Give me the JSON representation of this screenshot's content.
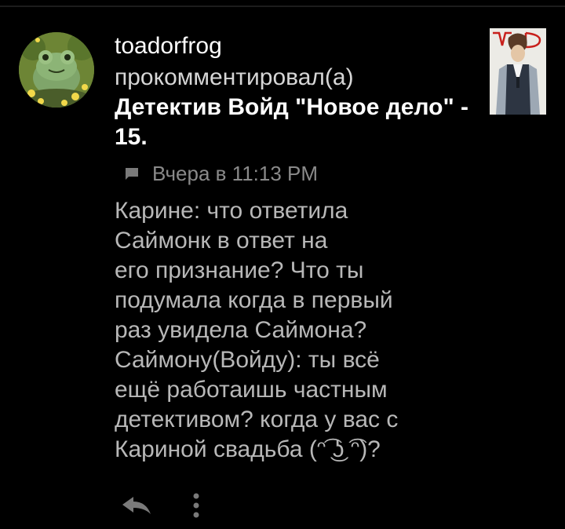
{
  "colors": {
    "background": "#000000",
    "username": "#ffffff",
    "action_text": "#d6d6d6",
    "title_text": "#ffffff",
    "meta_text": "#8a8a8a",
    "body_text": "#b8b8b8",
    "icon": "#7a7a7a"
  },
  "notification": {
    "username": "toadorfrog",
    "action": "прокомментировал(а)",
    "post_title": "Детектив Войд \"Новое дело\" - 15.",
    "timestamp": "Вчера в 11:13 PM",
    "comment_lines": [
      "Карине: что ответила",
      "Саймонк в ответ на",
      "его признание? Что ты",
      "подумала когда в первый",
      "раз увидела Саймона?",
      "Саймону(Войду): ты всё",
      "ещё работаишь частным",
      "детективом? когда у вас с",
      "Кариной свадьба (ᵔ͡ ͜ʖ ͡ᵔ)?"
    ]
  },
  "icons": {
    "comment": "comment-bubble-icon",
    "reply": "reply-arrow-icon",
    "more": "vertical-dots-icon"
  }
}
